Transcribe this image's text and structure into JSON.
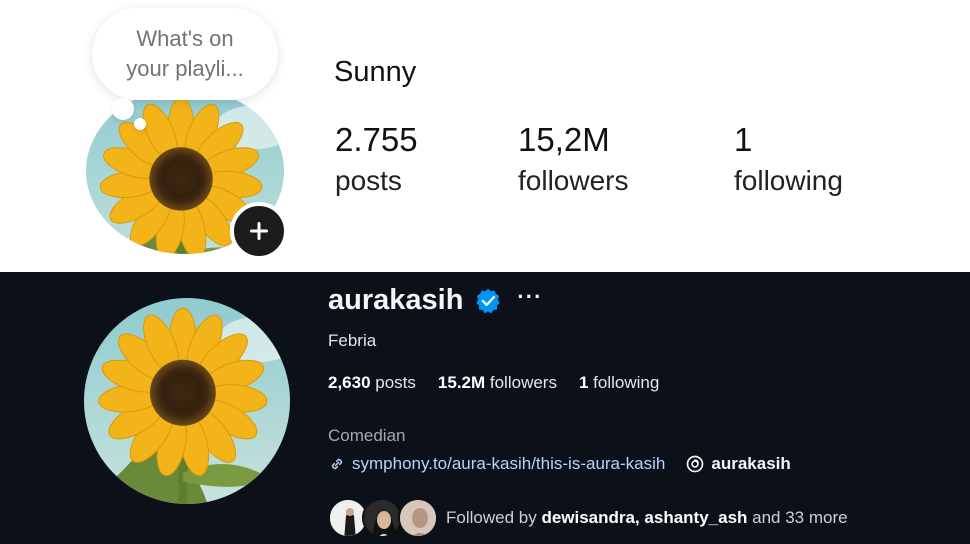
{
  "mobile_profile": {
    "note": {
      "line1": "What's on",
      "line2": "your playli..."
    },
    "name": "Sunny",
    "stats": [
      {
        "value": "2.755",
        "label": "posts"
      },
      {
        "value": "15,2M",
        "label": "followers"
      },
      {
        "value": "1",
        "label": "following"
      }
    ]
  },
  "desktop_profile": {
    "username": "aurakasih",
    "more_icon": "···",
    "full_name": "Febria",
    "stats": [
      {
        "value": "2,630",
        "label": " posts"
      },
      {
        "value": "15.2M",
        "label": " followers"
      },
      {
        "value": "1",
        "label": " following"
      }
    ],
    "category": "Comedian",
    "link": "symphony.to/aura-kasih/this-is-aura-kasih",
    "threads_handle": "aurakasih",
    "followed_by": {
      "prefix": "Followed by ",
      "names": "dewisandra, ashanty_ash",
      "suffix": " and 33 more"
    }
  },
  "colors": {
    "dark_bg": "#0c1019",
    "verified_blue": "#0095f6",
    "link_blue": "#b6d4fb"
  }
}
